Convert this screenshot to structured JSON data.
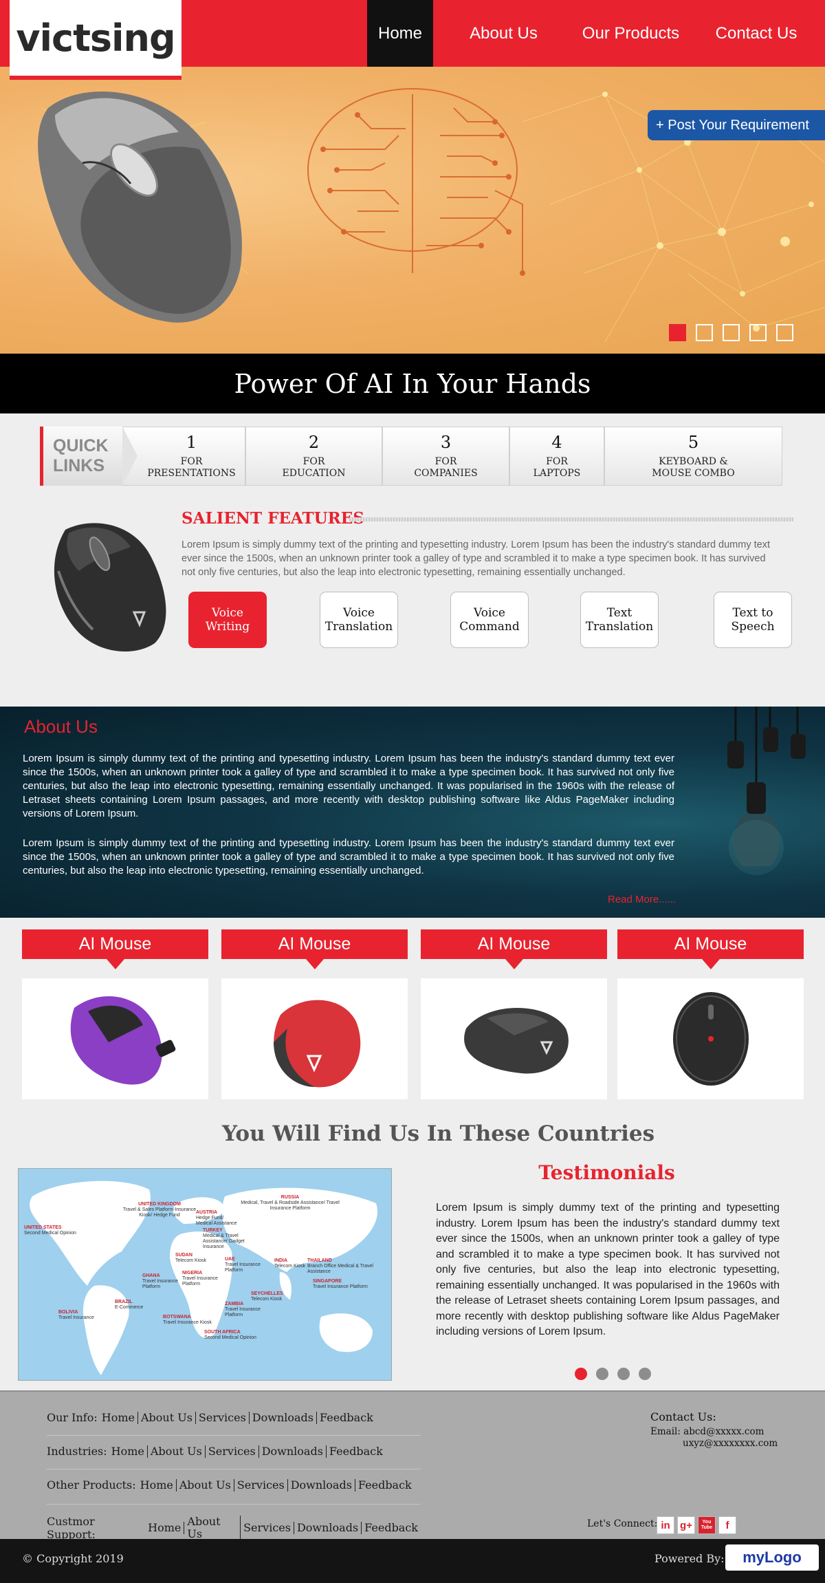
{
  "header": {
    "logo": "victsing",
    "nav": [
      {
        "label": "Home",
        "active": true
      },
      {
        "label": "About Us",
        "active": false
      },
      {
        "label": "Our Products",
        "active": false
      },
      {
        "label": "Contact Us",
        "active": false
      }
    ]
  },
  "hero": {
    "post_requirement": "+ Post Your Requirement",
    "slide_count": 5,
    "active_slide": 1
  },
  "banner": {
    "title": "Power Of AI In Your Hands"
  },
  "quick_links": {
    "label_line1": "QUICK",
    "label_line2": "LINKS",
    "items": [
      {
        "num": "1",
        "line1": "FOR",
        "line2": "PRESENTATIONS"
      },
      {
        "num": "2",
        "line1": "FOR",
        "line2": "EDUCATION"
      },
      {
        "num": "3",
        "line1": "FOR",
        "line2": "COMPANIES"
      },
      {
        "num": "4",
        "line1": "FOR",
        "line2": "LAPTOPS"
      },
      {
        "num": "5",
        "line1": "KEYBOARD &",
        "line2": "MOUSE COMBO"
      }
    ]
  },
  "salient": {
    "title": "SALIENT FEATURES",
    "text": "Lorem Ipsum is simply dummy text of the printing and typesetting industry. Lorem Ipsum has been the industry's standard dummy text ever since the 1500s, when an unknown printer took a galley of type and scrambled it to make a type specimen book. It has survived not only five centuries, but also the leap into electronic typesetting, remaining essentially unchanged.",
    "buttons": [
      {
        "line1": "Voice",
        "line2": "Writing"
      },
      {
        "line1": "Voice",
        "line2": "Translation"
      },
      {
        "line1": "Voice",
        "line2": "Command"
      },
      {
        "line1": "Text",
        "line2": "Translation"
      },
      {
        "line1": "Text to",
        "line2": "Speech"
      }
    ]
  },
  "about": {
    "title": "About Us",
    "p1": "Lorem Ipsum is simply dummy text of the printing and typesetting industry. Lorem Ipsum has been the industry's standard dummy text ever since the 1500s, when an unknown printer took a galley of type and scrambled it to make a type specimen book. It has survived not only five centuries, but also the leap into electronic typesetting, remaining essentially unchanged. It was popularised in the 1960s with the release of Letraset sheets containing Lorem Ipsum passages, and more recently with desktop publishing software like Aldus PageMaker including versions of Lorem Ipsum.",
    "p2": "Lorem Ipsum is simply dummy text of the printing and typesetting industry. Lorem Ipsum has been the industry's standard dummy text ever since the 1500s, when an unknown printer took a galley of type and scrambled it to make a type specimen book. It has survived not only five centuries, but also the leap into electronic typesetting, remaining essentially unchanged.",
    "read_more": "Read More......"
  },
  "products": [
    {
      "title": "AI Mouse",
      "color": "#8a3fc4"
    },
    {
      "title": "AI Mouse",
      "color": "#d8343a"
    },
    {
      "title": "AI Mouse",
      "color": "#3a3a3a"
    },
    {
      "title": "AI Mouse",
      "color": "#2b2b2b"
    }
  ],
  "countries": {
    "title": "You Will Find Us In These Countries",
    "labels": [
      {
        "name": "UNITED KINGDOM",
        "desc": "Travel & Sales Platform-Insurance Kiosk/ Hedge Fund"
      },
      {
        "name": "RUSSIA",
        "desc": "Medical, Travel & Roadside Assistance/ Travel Insurance Platform"
      },
      {
        "name": "AUSTRIA",
        "desc": "Hedge Fund/ Medical Assistance"
      },
      {
        "name": "UNITED STATES",
        "desc": "Second Medical Opinion"
      },
      {
        "name": "TURKEY",
        "desc": "Medical & Travel Assistance/ Gadget Insurance"
      },
      {
        "name": "SUDAN",
        "desc": "Telecom Kiosk"
      },
      {
        "name": "UAE",
        "desc": "Travel Insurance Platform"
      },
      {
        "name": "INDIA",
        "desc": "Telecom Kiosk"
      },
      {
        "name": "THAILAND",
        "desc": "Branch Office Medical & Travel Assistance"
      },
      {
        "name": "GHANA",
        "desc": "Travel Insurance Platform"
      },
      {
        "name": "NIGERIA",
        "desc": "Travel Insurance Platform"
      },
      {
        "name": "SINGAPORE",
        "desc": "Travel Insurance Platform"
      },
      {
        "name": "BRAZIL",
        "desc": "E-Commerce"
      },
      {
        "name": "SEYCHELLES",
        "desc": "Telecom Kiosk"
      },
      {
        "name": "BOLIVIA",
        "desc": "Travel Insurance"
      },
      {
        "name": "ZAMBIA",
        "desc": "Travel Insurance Platform"
      },
      {
        "name": "BOTSWANA",
        "desc": "Travel Insurance Kiosk"
      },
      {
        "name": "SOUTH AFRICA",
        "desc": "Second Medical Opinion"
      }
    ]
  },
  "testimonials": {
    "title": "Testimonials",
    "text": "Lorem Ipsum is simply dummy text of the printing and typesetting industry. Lorem Ipsum has been the industry's standard dummy text ever since the 1500s, when an unknown printer took a galley of type and scrambled it to make a type specimen book. It has survived not only five centuries, but also the leap into electronic typesetting, remaining essentially unchanged. It was popularised in the 1960s with the release of Letraset sheets containing Lorem Ipsum passages, and more recently with desktop publishing software like Aldus PageMaker including versions of Lorem Ipsum.",
    "dot_count": 4,
    "active_dot": 1
  },
  "footer": {
    "rows": [
      {
        "label": "Our Info: ",
        "links": [
          "Home",
          "About Us",
          "Services",
          "Downloads",
          "Feedback"
        ]
      },
      {
        "label": "Industries: ",
        "links": [
          "Home",
          "About Us",
          "Services",
          "Downloads",
          "Feedback"
        ]
      },
      {
        "label": "Other Products: ",
        "links": [
          "Home",
          "About Us",
          "Services",
          "Downloads",
          "Feedback"
        ]
      },
      {
        "label": "Custmor Support: ",
        "links": [
          "Home",
          "About Us",
          "Services",
          "Downloads",
          "Feedback"
        ]
      }
    ],
    "contact_title": "Contact Us:",
    "email_label": "Email: abcd@xxxxx.com",
    "email_2": "uxyz@xxxxxxxx.com",
    "connect": "Let's Connect:",
    "socials": [
      {
        "icon": "linkedin-icon",
        "glyph": "in"
      },
      {
        "icon": "google-plus-icon",
        "glyph": "g+"
      },
      {
        "icon": "youtube-icon",
        "glyph": "You Tube"
      },
      {
        "icon": "facebook-icon",
        "glyph": "f"
      }
    ],
    "copyright": "© Copyright 2019",
    "powered": "Powered By:",
    "powered_logo": "myLogo"
  },
  "colors": {
    "accent": "#e8232f",
    "button_blue": "#1c57a6",
    "dark": "#111111"
  }
}
